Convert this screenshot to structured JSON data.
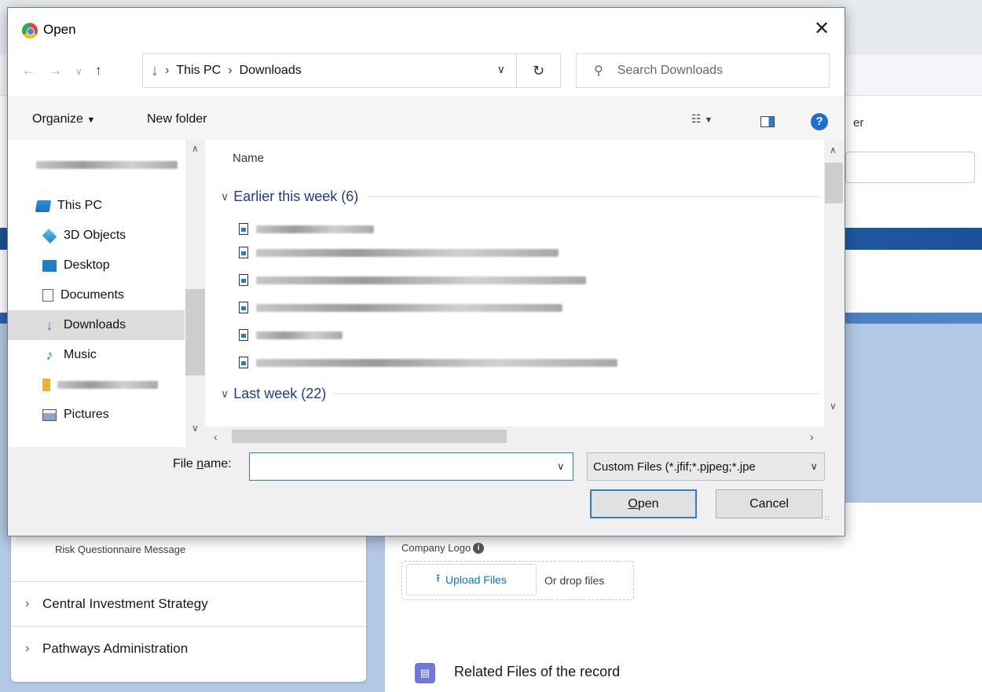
{
  "background": {
    "header_fragment": "er",
    "risk_message": "Risk Questionnaire Message",
    "accordion": [
      "Central Investment Strategy",
      "Pathways Administration"
    ],
    "company_logo_label": "Company Logo",
    "upload_button": "Upload Files",
    "drop_text": "Or drop files",
    "related_files_title": "Related Files of the record"
  },
  "dialog": {
    "title": "Open",
    "address": {
      "root": "This PC",
      "folder": "Downloads"
    },
    "search_placeholder": "Search Downloads",
    "toolbar": {
      "organize": "Organize",
      "new_folder": "New folder"
    },
    "tree": [
      "This PC",
      "3D Objects",
      "Desktop",
      "Documents",
      "Downloads",
      "Music",
      "Pictures"
    ],
    "column_name": "Name",
    "groups": [
      {
        "label": "Earlier this week (6)"
      },
      {
        "label": "Last week (22)"
      }
    ],
    "file_name_label_prefix": "File ",
    "file_name_label_underline": "n",
    "file_name_label_suffix": "ame:",
    "file_name_value": "",
    "filter": "Custom Files (*.jfif;*.pjpeg;*.jpe",
    "open_button_underline": "O",
    "open_button_rest": "pen",
    "cancel_button": "Cancel"
  }
}
